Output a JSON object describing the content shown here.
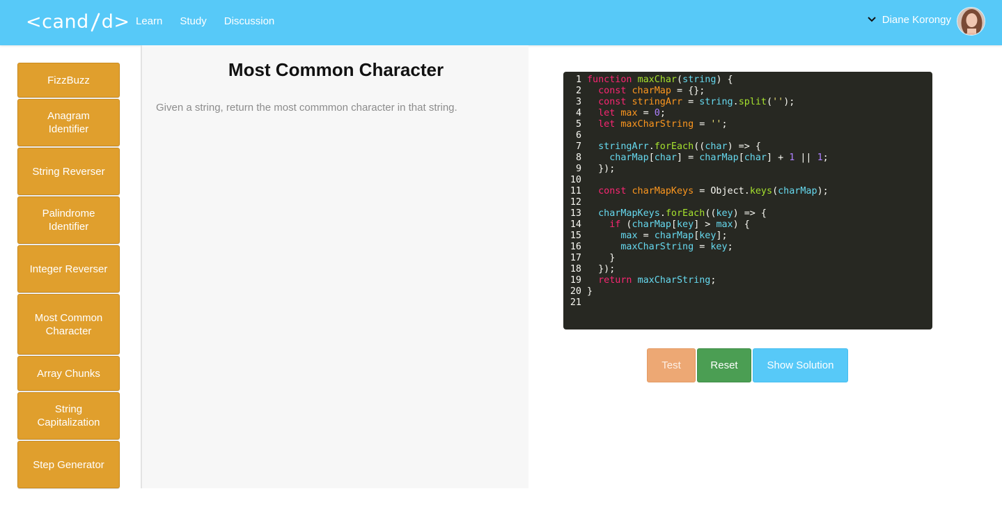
{
  "header": {
    "logo_left": "<cand",
    "logo_right": "d>",
    "nav": [
      "Learn",
      "Study",
      "Discussion"
    ],
    "user_name": "Diane Korongy",
    "icons": {
      "user_menu": "chevron-down-icon",
      "avatar": "user-avatar"
    }
  },
  "sidebar": {
    "items": [
      "FizzBuzz",
      "Anagram Identifier",
      "String Reverser",
      "Palindrome Identifier",
      "Integer Reverser",
      "Most Common Character",
      "Array Chunks",
      "String Capitalization",
      "Step Generator"
    ]
  },
  "problem": {
    "title": "Most Common Character",
    "description": "Given a string, return the most commmon character in that string."
  },
  "editor": {
    "line_numbers": [
      "1",
      "2",
      "3",
      "4",
      "5",
      "6",
      "7",
      "8",
      "9",
      "10",
      "11",
      "12",
      "13",
      "14",
      "15",
      "16",
      "17",
      "18",
      "19",
      "20",
      "21"
    ],
    "lines": [
      "function maxChar(string) {",
      "  const charMap = {};",
      "  const stringArr = string.split('');",
      "  let max = 0;",
      "  let maxCharString = '';",
      "",
      "  stringArr.forEach((char) => {",
      "    charMap[char] = charMap[char] + 1 || 1;",
      "  });",
      "",
      "  const charMapKeys = Object.keys(charMap);",
      "",
      "  charMapKeys.forEach((key) => {",
      "    if (charMap[key] > max) {",
      "      max = charMap[key];",
      "      maxCharString = key;",
      "    }",
      "  });",
      "  return maxCharString;",
      "}",
      ""
    ]
  },
  "actions": {
    "test": "Test",
    "reset": "Reset",
    "show_solution": "Show Solution"
  },
  "colors": {
    "header": "#57c9f8",
    "sidebar_button": "#e09f2d",
    "editor_bg": "#272822",
    "test_button": "#eda874",
    "reset_button": "#4b9e53",
    "solution_button": "#57c9f8"
  }
}
